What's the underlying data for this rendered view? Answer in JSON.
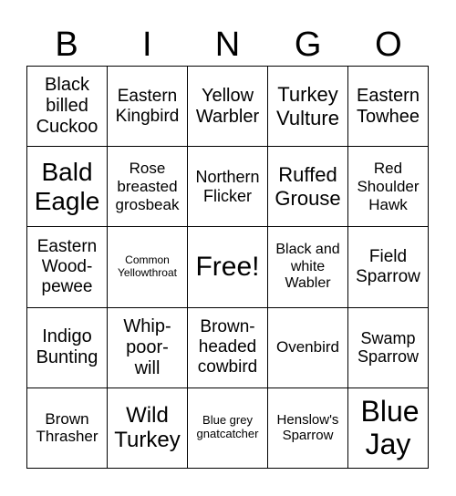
{
  "header": [
    "B",
    "I",
    "N",
    "G",
    "O"
  ],
  "cells": [
    "Black billed Cuckoo",
    "Eastern Kingbird",
    "Yellow Warbler",
    "Turkey Vulture",
    "Eastern Towhee",
    "Bald Eagle",
    "Rose breasted grosbeak",
    "Northern Flicker",
    "Ruffed Grouse",
    "Red Shoulder Hawk",
    "Eastern Wood-pewee",
    "Common Yellowthroat",
    "Free!",
    "Black and white Wabler",
    "Field Sparrow",
    "Indigo Bunting",
    "Whip-poor-will",
    "Brown-headed cowbird",
    "Ovenbird",
    "Swamp Sparrow",
    "Brown Thrasher",
    "Wild Turkey",
    "Blue grey gnatcatcher",
    "Henslow's Sparrow",
    "Blue Jay"
  ]
}
